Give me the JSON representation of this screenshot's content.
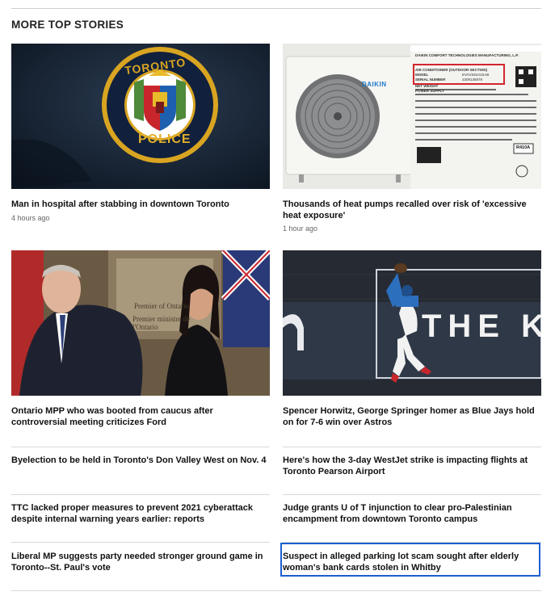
{
  "section": {
    "title": "MORE TOP STORIES"
  },
  "featured": [
    {
      "headline": "Man in hospital after stabbing in downtown Toronto",
      "time": "4 hours ago"
    },
    {
      "headline": "Thousands of heat pumps recalled over risk of 'excessive heat exposure'",
      "time": "1 hour ago"
    },
    {
      "headline": "Ontario MPP who was booted from caucus after controversial meeting criticizes Ford",
      "time": ""
    },
    {
      "headline": "Spencer Horwitz, George Springer homer as Blue Jays hold on for 7-6 win over Astros",
      "time": ""
    }
  ],
  "more": [
    {
      "headline": "Byelection to be held in Toronto's Don Valley West on Nov. 4"
    },
    {
      "headline": "Here's how the 3-day WestJet strike is impacting flights at Toronto Pearson Airport"
    },
    {
      "headline": "TTC lacked proper measures to prevent 2021 cyberattack despite internal warning years earlier: reports"
    },
    {
      "headline": "Judge grants U of T injunction to clear pro-Palestinian encampment from downtown Toronto campus"
    },
    {
      "headline": "Liberal MP suggests party needed stronger ground game in Toronto--St. Paul's vote"
    },
    {
      "headline": "Suspect in alleged parking lot scam sought after elderly woman's bank cards stolen in Whitby"
    }
  ],
  "images": {
    "police_patch": {
      "top_text": "TORONTO",
      "bottom_text": "POLICE"
    },
    "heat_pump": {
      "brand": "DAIKIN",
      "label_header": "DAIKIN COMFORT TECHNOLOGIES MANUFACTURING, L.P.",
      "label_line": "AIR CONDITIONER (OUTDOOR SECTION)",
      "model_label": "MODEL",
      "model_value": "EVAVS6241SAB",
      "serial_label": "SERIAL NUMBER",
      "serial_value": "2309136879",
      "weight_label": "NET WEIGHT",
      "power_label": "POWER SUPPLY",
      "badge": "R410A"
    },
    "press": {
      "sign_line1": "Premier of Ontario",
      "sign_line2": "Premier ministre de l'Ontario"
    },
    "baseball": {
      "wall_text": "THE K"
    }
  },
  "colors": {
    "focus": "#1a5fd0",
    "rule": "#d8d8d8",
    "timestamp": "#666666"
  }
}
